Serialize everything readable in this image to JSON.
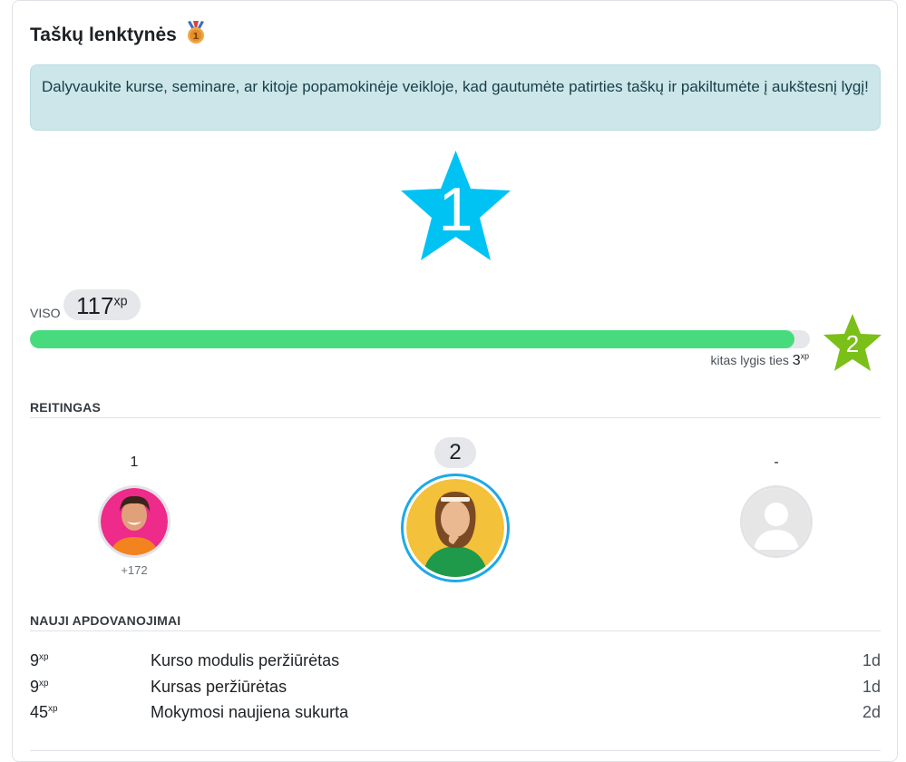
{
  "header": {
    "title": "Taškų lenktynės",
    "medal_icon": "medal-icon"
  },
  "info": {
    "text": "Dalyvaukite kurse, seminare, ar kitoje popamokinėje veikloje, kad gautumėte patirties taškų ir pakiltumėte į aukštesnį lygį!"
  },
  "level": {
    "current": "1",
    "next": "2",
    "star_color": "#00c3f4",
    "next_star_color": "#7bbf19"
  },
  "total": {
    "label": "VISO",
    "value": "117",
    "unit": "xp"
  },
  "progress": {
    "fraction": 0.98,
    "fill_color": "#48db7e",
    "next_label": "kitas lygis ties",
    "next_value": "3",
    "next_unit": "xp"
  },
  "ranking": {
    "heading": "REITINGAS",
    "entries": [
      {
        "rank": "1",
        "xp": "+172"
      },
      {
        "rank": "2"
      },
      {
        "rank": "-"
      }
    ]
  },
  "awards": {
    "heading": "NAUJI APDOVANOJIMAI",
    "unit": "xp",
    "rows": [
      {
        "xp": "9",
        "desc": "Kurso modulis peržiūrėtas",
        "time": "1d"
      },
      {
        "xp": "9",
        "desc": "Kursas peržiūrėtas",
        "time": "1d"
      },
      {
        "xp": "45",
        "desc": "Mokymosi naujiena sukurta",
        "time": "2d"
      }
    ]
  }
}
